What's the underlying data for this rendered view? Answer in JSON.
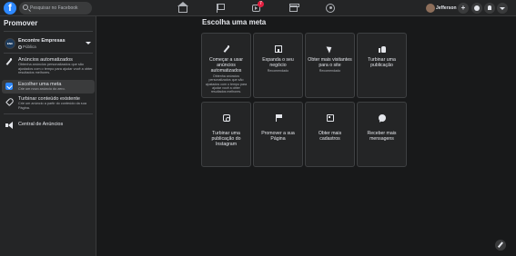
{
  "topbar": {
    "logo": "f",
    "search_placeholder": "Pesquisar no Facebook",
    "notification_badge": "7",
    "profile_name": "Jefferson"
  },
  "sidebar": {
    "title": "Promover",
    "page": {
      "name": "Encontre Empresas",
      "visibility": "Pública",
      "avatar_text": "ENC"
    },
    "items": [
      {
        "label": "Anúncios automatizados",
        "description": "Obtenha anúncios personalizados que são ajustados com o tempo para ajudar você a obter resultados melhores."
      },
      {
        "label": "Escolher uma meta",
        "description": "Crie um novo anúncio do zero."
      },
      {
        "label": "Turbinar conteúdo existente",
        "description": "Crie um anúncio a partir do conteúdo da sua Página."
      },
      {
        "label": "Central de Anúncios",
        "description": ""
      }
    ]
  },
  "main": {
    "title": "Escolha uma meta",
    "cards": [
      {
        "title": "Começar a usar anúncios automatizados",
        "description": "Obtenha anúncios personalizados que são ajustados com o tempo para ajudar você a obter resultados melhores.",
        "icon": "magic-wand-icon"
      },
      {
        "title": "Expanda o seu negócio",
        "description": "Recomendado",
        "icon": "store-icon"
      },
      {
        "title": "Obter mais visitantes para o site",
        "description": "Recomendado",
        "icon": "cursor-icon"
      },
      {
        "title": "Turbinar uma publicação",
        "description": "",
        "icon": "thumbs-up-icon"
      },
      {
        "title": "Turbinar uma publicação do Instagram",
        "description": "",
        "icon": "instagram-icon"
      },
      {
        "title": "Promover a sua Página",
        "description": "",
        "icon": "flag-icon"
      },
      {
        "title": "Obter mais cadastros",
        "description": "",
        "icon": "id-card-icon"
      },
      {
        "title": "Receber mais mensagens",
        "description": "",
        "icon": "chat-icon"
      }
    ]
  },
  "colors": {
    "background": "#18191a",
    "surface": "#242526",
    "accent": "#2d88ff",
    "badge": "#e41e3f"
  }
}
